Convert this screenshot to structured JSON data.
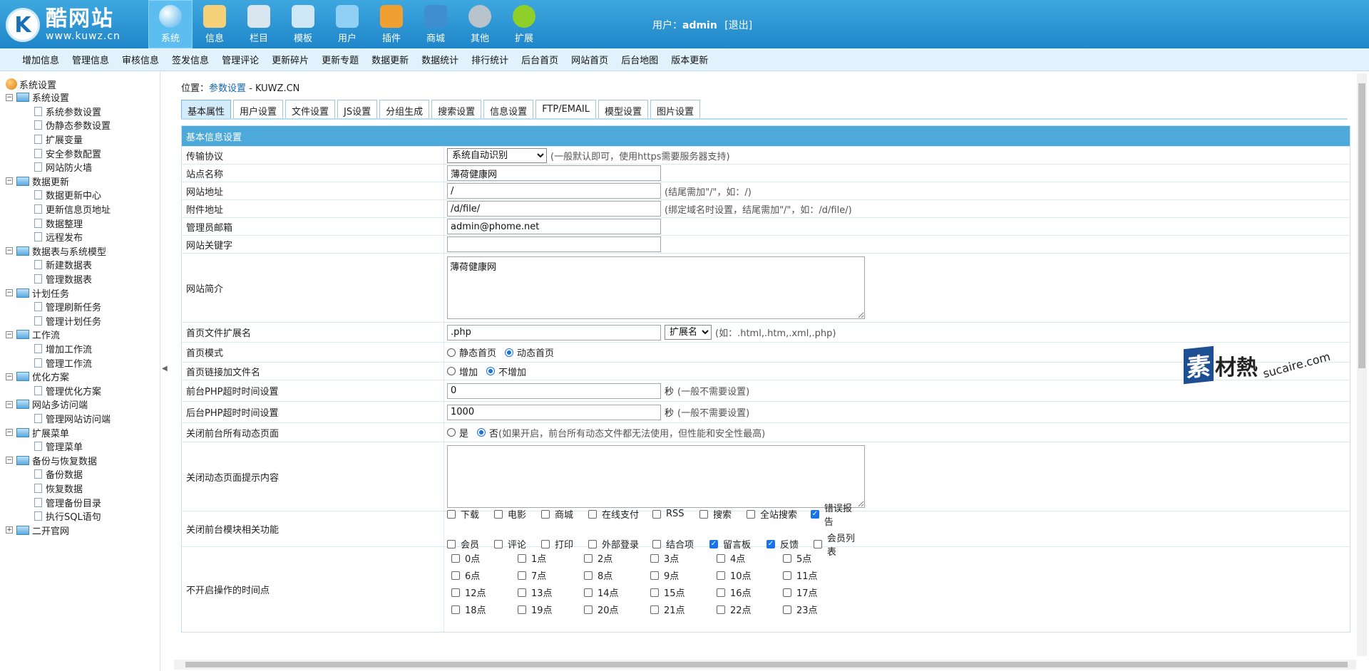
{
  "logo": {
    "title": "酷网站",
    "url": "www.kuwz.cn"
  },
  "nav": [
    {
      "label": "系统",
      "icon": "globe-icon",
      "color": "#ffffff",
      "active": true
    },
    {
      "label": "信息",
      "icon": "notepad-icon",
      "color": "#f5d27a"
    },
    {
      "label": "栏目",
      "icon": "folder-icon",
      "color": "#d9e6ef"
    },
    {
      "label": "模板",
      "icon": "window-icon",
      "color": "#cfe6f7"
    },
    {
      "label": "用户",
      "icon": "user-icon",
      "color": "#8fd0f4"
    },
    {
      "label": "插件",
      "icon": "tools-icon",
      "color": "#f0a030"
    },
    {
      "label": "商城",
      "icon": "card-icon",
      "color": "#3f8fd0"
    },
    {
      "label": "其他",
      "icon": "gear-icon",
      "color": "#b9c3cc"
    },
    {
      "label": "扩展",
      "icon": "plus-icon",
      "color": "#8fcf2a"
    }
  ],
  "user": {
    "prefix": "用户：",
    "name": "admin",
    "logout": "[退出]"
  },
  "menubar": [
    "增加信息",
    "管理信息",
    "审核信息",
    "签发信息",
    "管理评论",
    "更新碎片",
    "更新专题",
    "数据更新",
    "数据统计",
    "排行统计",
    "后台首页",
    "网站首页",
    "后台地图",
    "版本更新"
  ],
  "sidebar": {
    "root": "系统设置",
    "groups": [
      {
        "label": "系统设置",
        "items": [
          "系统参数设置",
          "伪静态参数设置",
          "扩展变量",
          "安全参数配置",
          "网站防火墙"
        ]
      },
      {
        "label": "数据更新",
        "items": [
          "数据更新中心",
          "更新信息页地址",
          "数据整理",
          "远程发布"
        ]
      },
      {
        "label": "数据表与系统模型",
        "items": [
          "新建数据表",
          "管理数据表"
        ]
      },
      {
        "label": "计划任务",
        "items": [
          "管理刷新任务",
          "管理计划任务"
        ]
      },
      {
        "label": "工作流",
        "items": [
          "增加工作流",
          "管理工作流"
        ]
      },
      {
        "label": "优化方案",
        "items": [
          "管理优化方案"
        ]
      },
      {
        "label": "网站多访问端",
        "items": [
          "管理网站访问端"
        ]
      },
      {
        "label": "扩展菜单",
        "items": [
          "管理菜单"
        ]
      },
      {
        "label": "备份与恢复数据",
        "items": [
          "备份数据",
          "恢复数据",
          "管理备份目录",
          "执行SQL语句"
        ]
      },
      {
        "label": "二开官网",
        "items": [],
        "collapsed": true
      }
    ]
  },
  "location": {
    "label": "位置：",
    "link": "参数设置",
    "suffix": " - KUWZ.CN"
  },
  "tabs": [
    "基本属性",
    "用户设置",
    "文件设置",
    "JS设置",
    "分组生成",
    "搜索设置",
    "信息设置",
    "FTP/EMAIL",
    "模型设置",
    "图片设置"
  ],
  "form": {
    "header": "基本信息设置",
    "protocol": {
      "label": "传输协议",
      "value": "系统自动识别",
      "hint": "(一般默认即可，使用https需要服务器支持)"
    },
    "sitename": {
      "label": "站点名称",
      "value": "薄荷健康网"
    },
    "siteurl": {
      "label": "网站地址",
      "value": "/",
      "hint": "(结尾需加\"/\"，如：/)"
    },
    "fileurl": {
      "label": "附件地址",
      "value": "/d/file/",
      "hint": "(绑定域名时设置，结尾需加\"/\"，如：/d/file/)"
    },
    "email": {
      "label": "管理员邮箱",
      "value": "admin@phome.net"
    },
    "keywords": {
      "label": "网站关键字",
      "value": ""
    },
    "intro": {
      "label": "网站简介",
      "value": "薄荷健康网"
    },
    "indexext": {
      "label": "首页文件扩展名",
      "value": ".php",
      "select": "扩展名",
      "hint": "(如：.html,.htm,.xml,.php)"
    },
    "indexmode": {
      "label": "首页模式",
      "opt1": "静态首页",
      "opt2": "动态首页"
    },
    "indexlink": {
      "label": "首页链接加文件名",
      "opt1": "增加",
      "opt2": "不增加"
    },
    "fronttimeout": {
      "label": "前台PHP超时时间设置",
      "value": "0",
      "unit": "秒",
      "hint": "(一般不需要设置)"
    },
    "backtimeout": {
      "label": "后台PHP超时时间设置",
      "value": "1000",
      "unit": "秒",
      "hint": "(一般不需要设置)"
    },
    "closedyn": {
      "label": "关闭前台所有动态页面",
      "opt1": "是",
      "opt2": "否",
      "hint": "(如果开启，前台所有动态文件都无法使用，但性能和安全性最高)"
    },
    "closetip": {
      "label": "关闭动态页面提示内容",
      "value": ""
    },
    "modules": {
      "label": "关闭前台模块相关功能",
      "row1": [
        {
          "t": "下载",
          "on": false
        },
        {
          "t": "电影",
          "on": false
        },
        {
          "t": "商城",
          "on": false
        },
        {
          "t": "在线支付",
          "on": false
        },
        {
          "t": "RSS",
          "on": false
        },
        {
          "t": "搜索",
          "on": false
        },
        {
          "t": "全站搜索",
          "on": false
        },
        {
          "t": "错误报告",
          "on": true
        }
      ],
      "row2": [
        {
          "t": "会员",
          "on": false
        },
        {
          "t": "评论",
          "on": false
        },
        {
          "t": "打印",
          "on": false
        },
        {
          "t": "外部登录",
          "on": false
        },
        {
          "t": "结合项",
          "on": false
        },
        {
          "t": "留言板",
          "on": true
        },
        {
          "t": "反馈",
          "on": true
        },
        {
          "t": "会员列表",
          "on": false
        }
      ]
    },
    "hours": {
      "label": "不开启操作的时间点",
      "list": [
        "0点",
        "1点",
        "2点",
        "3点",
        "4点",
        "5点",
        "6点",
        "7点",
        "8点",
        "9点",
        "10点",
        "11点",
        "12点",
        "13点",
        "14点",
        "15点",
        "16点",
        "17点",
        "18点",
        "19点",
        "20点",
        "21点",
        "22点",
        "23点"
      ]
    }
  },
  "watermark": {
    "a": "素",
    "b": "材熱",
    "c": "sucaire.com"
  }
}
